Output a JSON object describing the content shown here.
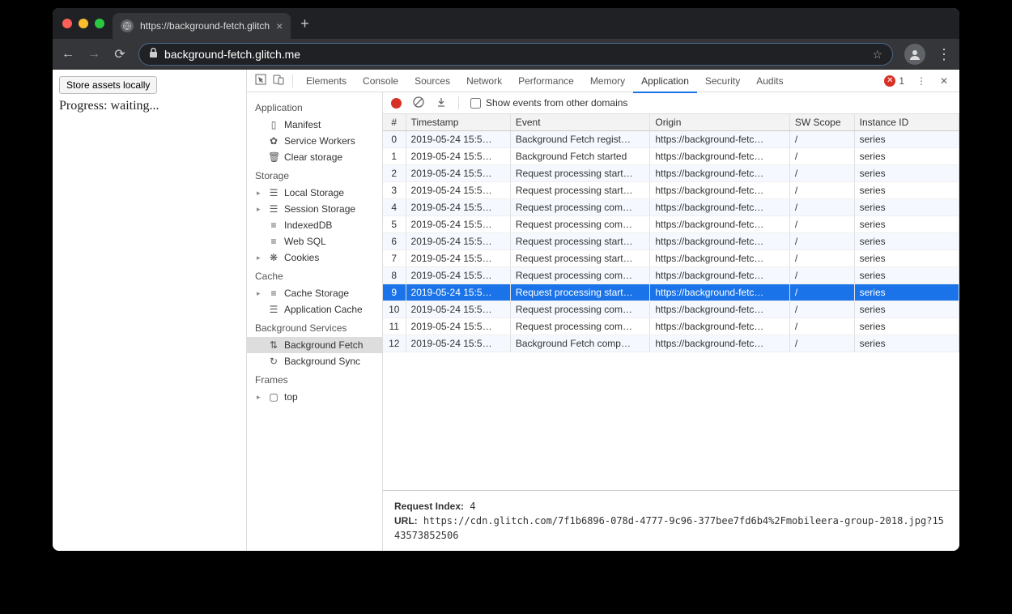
{
  "browser": {
    "tab_title": "https://background-fetch.glitch",
    "url_display": "background-fetch.glitch.me"
  },
  "page": {
    "button_label": "Store assets locally",
    "progress_text": "Progress: waiting..."
  },
  "devtools": {
    "tabs": [
      "Elements",
      "Console",
      "Sources",
      "Network",
      "Performance",
      "Memory",
      "Application",
      "Security",
      "Audits"
    ],
    "active_tab": "Application",
    "error_count": "1"
  },
  "sidebar": {
    "sections": [
      {
        "title": "Application",
        "items": [
          {
            "label": "Manifest",
            "icon": "▯"
          },
          {
            "label": "Service Workers",
            "icon": "✿"
          },
          {
            "label": "Clear storage",
            "icon": "🗑"
          }
        ]
      },
      {
        "title": "Storage",
        "items": [
          {
            "label": "Local Storage",
            "icon": "☰",
            "expandable": true
          },
          {
            "label": "Session Storage",
            "icon": "☰",
            "expandable": true
          },
          {
            "label": "IndexedDB",
            "icon": "≡"
          },
          {
            "label": "Web SQL",
            "icon": "≡"
          },
          {
            "label": "Cookies",
            "icon": "❋",
            "expandable": true
          }
        ]
      },
      {
        "title": "Cache",
        "items": [
          {
            "label": "Cache Storage",
            "icon": "≡",
            "expandable": true
          },
          {
            "label": "Application Cache",
            "icon": "☰"
          }
        ]
      },
      {
        "title": "Background Services",
        "items": [
          {
            "label": "Background Fetch",
            "icon": "⇅",
            "selected": true
          },
          {
            "label": "Background Sync",
            "icon": "↻"
          }
        ]
      },
      {
        "title": "Frames",
        "items": [
          {
            "label": "top",
            "icon": "▢",
            "expandable": true
          }
        ]
      }
    ]
  },
  "toolbar": {
    "checkbox_label": "Show events from other domains"
  },
  "table": {
    "headers": [
      "#",
      "Timestamp",
      "Event",
      "Origin",
      "SW Scope",
      "Instance ID"
    ],
    "rows": [
      {
        "n": "0",
        "ts": "2019-05-24 15:5…",
        "ev": "Background Fetch regist…",
        "or": "https://background-fetc…",
        "sw": "/",
        "id": "series"
      },
      {
        "n": "1",
        "ts": "2019-05-24 15:5…",
        "ev": "Background Fetch started",
        "or": "https://background-fetc…",
        "sw": "/",
        "id": "series"
      },
      {
        "n": "2",
        "ts": "2019-05-24 15:5…",
        "ev": "Request processing start…",
        "or": "https://background-fetc…",
        "sw": "/",
        "id": "series"
      },
      {
        "n": "3",
        "ts": "2019-05-24 15:5…",
        "ev": "Request processing start…",
        "or": "https://background-fetc…",
        "sw": "/",
        "id": "series"
      },
      {
        "n": "4",
        "ts": "2019-05-24 15:5…",
        "ev": "Request processing com…",
        "or": "https://background-fetc…",
        "sw": "/",
        "id": "series"
      },
      {
        "n": "5",
        "ts": "2019-05-24 15:5…",
        "ev": "Request processing com…",
        "or": "https://background-fetc…",
        "sw": "/",
        "id": "series"
      },
      {
        "n": "6",
        "ts": "2019-05-24 15:5…",
        "ev": "Request processing start…",
        "or": "https://background-fetc…",
        "sw": "/",
        "id": "series"
      },
      {
        "n": "7",
        "ts": "2019-05-24 15:5…",
        "ev": "Request processing start…",
        "or": "https://background-fetc…",
        "sw": "/",
        "id": "series"
      },
      {
        "n": "8",
        "ts": "2019-05-24 15:5…",
        "ev": "Request processing com…",
        "or": "https://background-fetc…",
        "sw": "/",
        "id": "series"
      },
      {
        "n": "9",
        "ts": "2019-05-24 15:5…",
        "ev": "Request processing start…",
        "or": "https://background-fetc…",
        "sw": "/",
        "id": "series",
        "selected": true
      },
      {
        "n": "10",
        "ts": "2019-05-24 15:5…",
        "ev": "Request processing com…",
        "or": "https://background-fetc…",
        "sw": "/",
        "id": "series"
      },
      {
        "n": "11",
        "ts": "2019-05-24 15:5…",
        "ev": "Request processing com…",
        "or": "https://background-fetc…",
        "sw": "/",
        "id": "series"
      },
      {
        "n": "12",
        "ts": "2019-05-24 15:5…",
        "ev": "Background Fetch comp…",
        "or": "https://background-fetc…",
        "sw": "/",
        "id": "series"
      }
    ]
  },
  "details": {
    "request_index_label": "Request Index:",
    "request_index_value": "4",
    "url_label": "URL:",
    "url_value": "https://cdn.glitch.com/7f1b6896-078d-4777-9c96-377bee7fd6b4%2Fmobileera-group-2018.jpg?1543573852506"
  }
}
